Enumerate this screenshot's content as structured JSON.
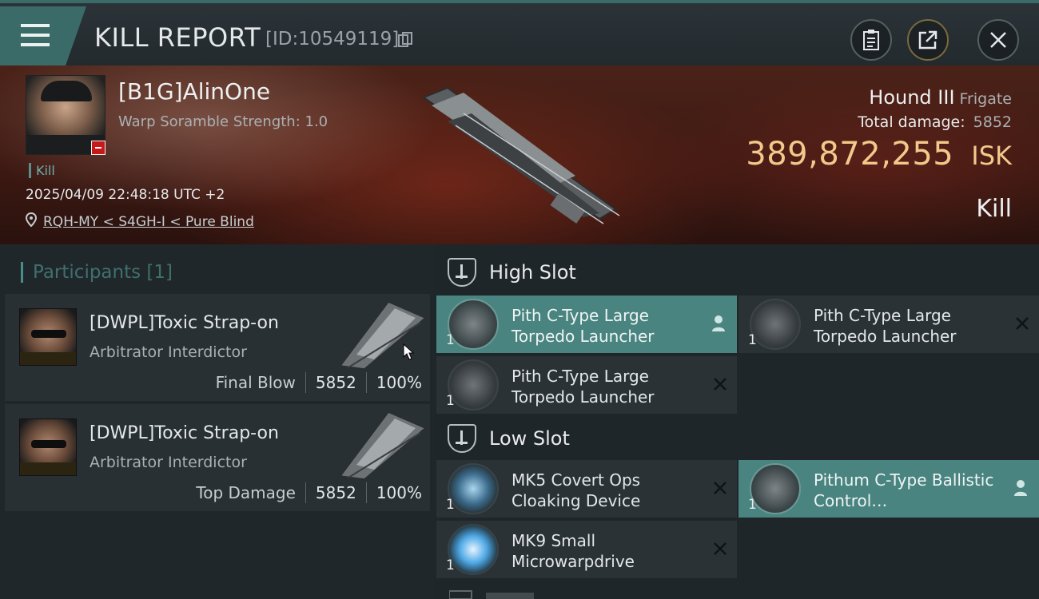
{
  "header": {
    "title": "KILL REPORT",
    "report_id": "[ID:10549119]",
    "icons": {
      "menu": "menu-icon",
      "copy": "copy-icon",
      "clipboard": "clipboard-icon",
      "share": "share-icon",
      "close": "close-icon"
    }
  },
  "victim": {
    "name": "[B1G]AlinOne",
    "warp_scramble": "Warp Soramble Strength: 1.0",
    "kill_tag": "Kill",
    "timestamp": "2025/04/09 22:48:18 UTC +2",
    "location": "RQH-MY < S4GH-I < Pure Blind",
    "ship_name": "Hound III",
    "ship_class": "Frigate",
    "total_damage_label": "Total damage:",
    "total_damage": "5852",
    "isk_value": "389,872,255",
    "isk_unit": "ISK",
    "result": "Kill"
  },
  "participants": {
    "label": "Participants",
    "count": "[1]",
    "items": [
      {
        "name": "[DWPL]Toxic Strap-on",
        "ship": "Arbitrator Interdictor",
        "stat_label": "Final Blow",
        "damage": "5852",
        "percent": "100%"
      },
      {
        "name": "[DWPL]Toxic Strap-on",
        "ship": "Arbitrator Interdictor",
        "stat_label": "Top Damage",
        "damage": "5852",
        "percent": "100%"
      }
    ]
  },
  "fitting": {
    "high_slot": {
      "title": "High Slot",
      "modules": [
        {
          "name": "Pith C-Type Large Torpedo Launcher",
          "qty": "1",
          "status": "dropped"
        },
        {
          "name": "Pith C-Type Large Torpedo Launcher",
          "qty": "1",
          "status": "destroyed"
        },
        {
          "name": "Pith C-Type Large Torpedo Launcher",
          "qty": "1",
          "status": "destroyed"
        }
      ]
    },
    "low_slot": {
      "title": "Low Slot",
      "modules": [
        {
          "name": "MK5 Covert Ops Cloaking Device",
          "qty": "1",
          "status": "destroyed"
        },
        {
          "name": "Pithum C-Type Ballistic Control…",
          "qty": "1",
          "status": "dropped"
        },
        {
          "name": "MK9 Small Microwarpdrive",
          "qty": "1",
          "status": "destroyed"
        }
      ]
    }
  },
  "colors": {
    "accent": "#4a8480",
    "isk": "#f2c98b",
    "badge": "#c8191a"
  }
}
